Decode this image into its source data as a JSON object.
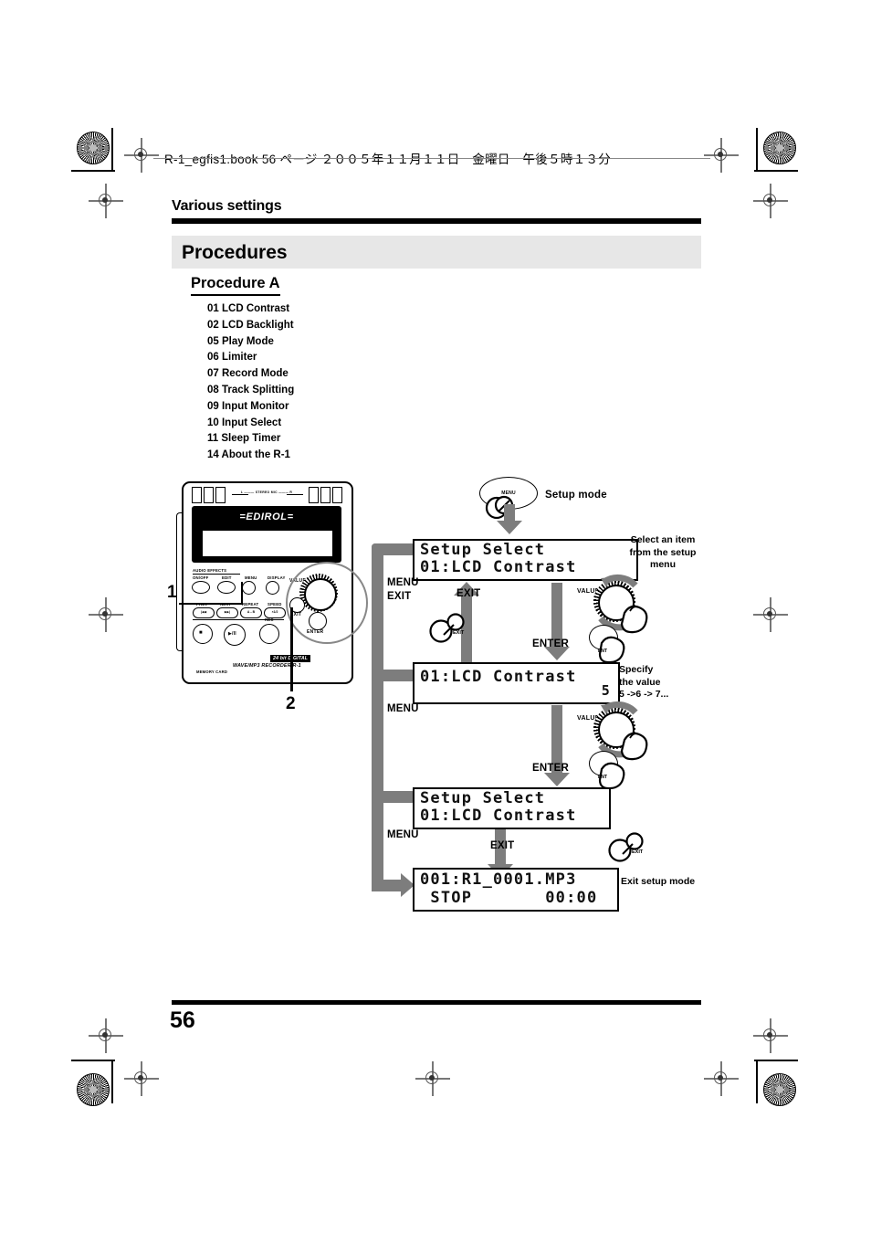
{
  "page": {
    "header_line": "R-1_egfis1.book  56 ページ  ２００５年１１月１１日　金曜日　午後５時１３分",
    "section_title": "Various settings",
    "page_number": "56"
  },
  "headings": {
    "procedures": "Procedures",
    "procedure_a": "Procedure A"
  },
  "menu_items": [
    "01 LCD Contrast",
    "02 LCD Backlight",
    "05 Play Mode",
    "06 Limiter",
    "07 Record Mode",
    "08 Track Splitting",
    "09 Input Monitor",
    "10 Input Select",
    "11 Sleep Timer",
    "14 About the R-1"
  ],
  "device": {
    "brand": "=EDIROL=",
    "mic_label": "L ——— STEREO MIC ——— R",
    "audio_effects_label": "AUDIO EFFECTS",
    "buttons": {
      "on_off": "ON/OFF",
      "edit": "EDIT",
      "menu": "MENU",
      "display": "DISPLAY",
      "prev": "PREV",
      "next": "NEXT",
      "repeat": "REPEAT",
      "speed": "SPEED",
      "rec": "REC",
      "exit": "EXIT",
      "enter": "ENTER",
      "value": "VALUE",
      "prev_glyph": "|◀◀",
      "next_glyph": "▶▶|",
      "repeat_glyph": "A↔B",
      "speed_glyph": "×1/2",
      "stop_glyph": "■",
      "play_glyph": "▶/II"
    },
    "brand_tag_1": "24 bit DIGITAL",
    "brand_tag_2": "WAVE/MP3 RECORDER R-1",
    "memory_card": "MEMORY CARD",
    "callout_1": "1",
    "callout_2": "2"
  },
  "flow": {
    "setup_mode_label": "Setup mode",
    "menu_button_label": "MENU",
    "exit_button_label": "EXIT",
    "enter_button_label": "ENTER",
    "value_label": "VALUE",
    "labels": {
      "menu_exit_1": "MENU",
      "menu_exit_2": "EXIT",
      "exit_arrow": "EXIT",
      "enter_arrow_1": "ENTER",
      "menu_2": "MENU",
      "enter_arrow_2": "ENTER",
      "menu_3": "MENU",
      "exit_arrow_2": "EXIT"
    },
    "screens": [
      {
        "line1": "Setup Select",
        "line2": "01:LCD Contrast",
        "value": ""
      },
      {
        "line1": "01:LCD Contrast",
        "line2": "",
        "value": "5"
      },
      {
        "line1": "Setup Select",
        "line2": "01:LCD Contrast",
        "value": ""
      },
      {
        "line1": "001:R1_0001.MP3",
        "line2": " STOP       00:00",
        "value": ""
      }
    ],
    "notes": {
      "select_item": "Select an item\nfrom the setup\nmenu",
      "specify_value": "Specify\nthe value\n5 ->6 -> 7...",
      "exit_setup": "Exit setup mode"
    }
  },
  "colors": {
    "arrow_grey": "#7d7d7d",
    "band_grey": "#e7e7e7",
    "ink": "#000000"
  }
}
